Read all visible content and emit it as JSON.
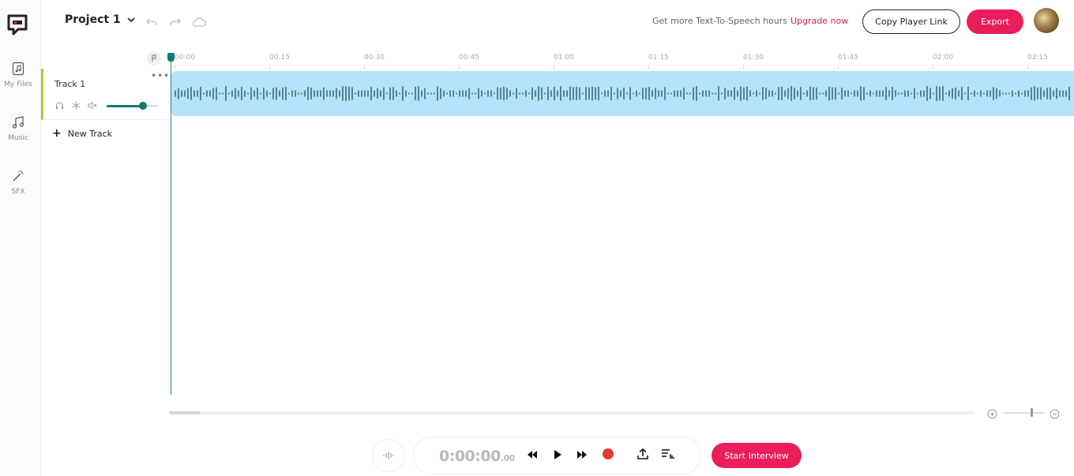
{
  "sidebar": {
    "items": [
      {
        "label": "My Files",
        "icon": "music-file-icon"
      },
      {
        "label": "Music",
        "icon": "music-note-icon"
      },
      {
        "label": "SFX",
        "icon": "magic-wand-icon"
      }
    ]
  },
  "header": {
    "project_title": "Project 1",
    "tts_text": "Get more Text-To-Speech hours",
    "upgrade_link": "Upgrade now",
    "copy_link_label": "Copy Player Link",
    "export_label": "Export"
  },
  "tracks": [
    {
      "name": "Track 1",
      "volume": 0.7
    }
  ],
  "new_track_label": "New Track",
  "timeline": {
    "ticks": [
      "00:00",
      "00:15",
      "00:30",
      "00:45",
      "01:00",
      "01:15",
      "01:30",
      "01:45",
      "02:00",
      "02:15"
    ]
  },
  "transport": {
    "time_main": "0:00:00",
    "time_fraction": ".00",
    "start_interview_label": "Start Interview"
  },
  "colors": {
    "accent": "#e91e5a",
    "teal": "#0f7a6e",
    "clip": "#b4e4fa",
    "track_marker": "#b5cb41"
  }
}
